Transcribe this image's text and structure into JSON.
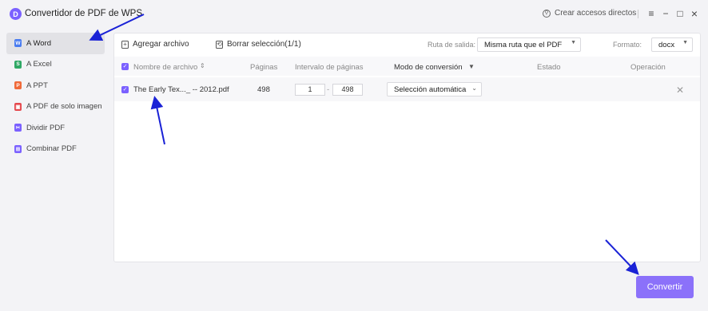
{
  "app": {
    "logo_letter": "D",
    "title": "Convertidor de PDF de WPS"
  },
  "titlebar": {
    "shortcut_label": "Crear accesos directos",
    "shortcut_icon": "link-icon",
    "menu_icon": "≡",
    "minimize_icon": "−",
    "maximize_icon": "□",
    "close_icon": "×"
  },
  "sidebar": {
    "items": [
      {
        "label": "A Word",
        "icon": "W",
        "color": "#4a7cf0",
        "active": true
      },
      {
        "label": "A Excel",
        "icon": "S",
        "color": "#2fa865"
      },
      {
        "label": "A PPT",
        "icon": "P",
        "color": "#f06a3a"
      },
      {
        "label": "A PDF de solo imagen",
        "icon": "▣",
        "color": "#e5484d"
      },
      {
        "label": "Dividir PDF",
        "icon": "✂",
        "color": "#7b61ff"
      },
      {
        "label": "Combinar PDF",
        "icon": "⊞",
        "color": "#7b61ff"
      }
    ]
  },
  "toolbar": {
    "add_label": "Agregar archivo",
    "clear_label": "Borrar selección(1/1)",
    "output_label": "Ruta de salida:",
    "output_value": "Misma ruta que el PDF",
    "format_label": "Formato:",
    "format_value": "docx"
  },
  "table": {
    "headers": {
      "name": "Nombre de archivo",
      "pages": "Páginas",
      "range": "Intervalo de páginas",
      "mode": "Modo de conversión",
      "status": "Estado",
      "operation": "Operación"
    },
    "rows": [
      {
        "name": "The Early Tex..._ -- 2012.pdf",
        "pages": "498",
        "from": "1",
        "to": "498",
        "mode": "Selección automática"
      }
    ]
  },
  "convert_label": "Convertir",
  "colors": {
    "accent": "#7b61ff",
    "arrow": "#1a22d6"
  }
}
